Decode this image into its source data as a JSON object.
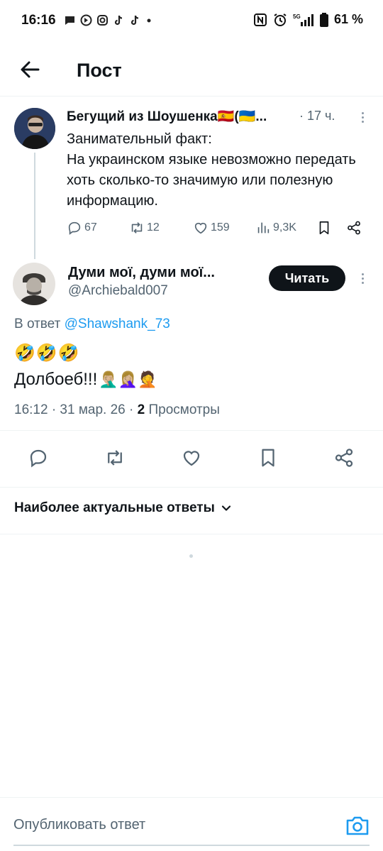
{
  "status_bar": {
    "time": "16:16",
    "battery": "61 %",
    "network": "5G"
  },
  "header": {
    "title": "Пост"
  },
  "parent_tweet": {
    "author_name": "Бегущий из Шоушенка🇪🇸(🇺🇦...",
    "time": "· 17 ч.",
    "text_line1": "Занимательный факт:",
    "text_line2": "На украинском языке невозможно передать хоть сколько-то значимую или полезную информацию.",
    "replies": "67",
    "reposts": "12",
    "likes": "159",
    "views": "9,3K"
  },
  "main_tweet": {
    "author_name": "Думи мої, думи мої...",
    "handle": "@Archiebald007",
    "follow_label": "Читать",
    "reply_prefix": "В ответ ",
    "reply_mention": "@Shawshank_73",
    "emojis": "🤣🤣🤣",
    "text": "Долбоеб!!!",
    "text_emojis": "🤦🏼‍♂️🤦🏼‍♀️🤦",
    "timestamp": "16:12 · 31 мар. 26 · ",
    "views_count": "2",
    "views_label": " Просмотры"
  },
  "replies_sort": {
    "label": "Наиболее актуальные ответы"
  },
  "composer": {
    "placeholder": "Опубликовать ответ"
  },
  "colors": {
    "accent": "#1d9bf0",
    "text": "#0f1419",
    "secondary": "#536471",
    "button_bg": "#0f1419"
  }
}
